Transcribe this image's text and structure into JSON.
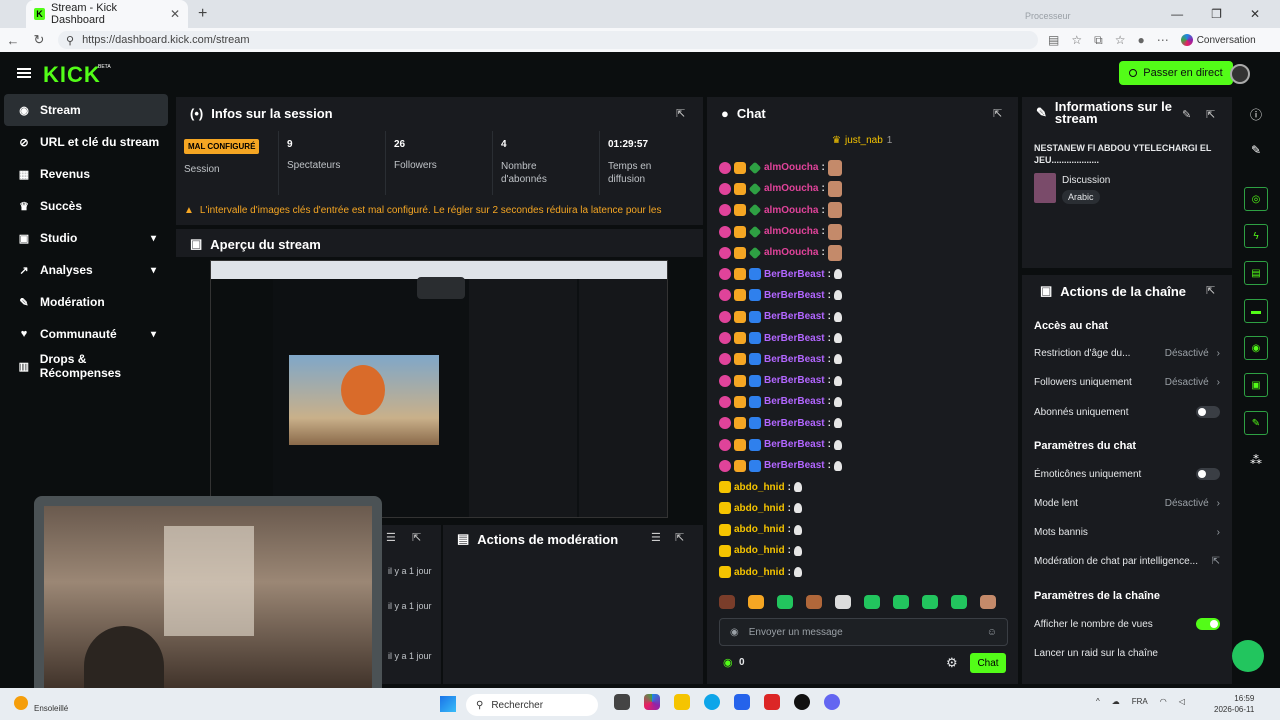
{
  "browser": {
    "tab_title": "Stream - Kick Dashboard",
    "url": "https://dashboard.kick.com/stream",
    "conversation_label": "Conversation",
    "processor_label": "Processeur"
  },
  "header": {
    "logo": "KICK",
    "beta": "BETA",
    "go_live_label": "Passer en direct"
  },
  "sidebar": {
    "items": [
      {
        "label": "Stream",
        "icon": "broadcast-icon"
      },
      {
        "label": "URL et clé du stream",
        "icon": "link-icon"
      },
      {
        "label": "Revenus",
        "icon": "money-icon"
      },
      {
        "label": "Succès",
        "icon": "trophy-icon"
      },
      {
        "label": "Studio",
        "icon": "studio-icon"
      },
      {
        "label": "Analyses",
        "icon": "chart-icon"
      },
      {
        "label": "Modération",
        "icon": "wrench-icon"
      },
      {
        "label": "Communauté",
        "icon": "community-icon"
      },
      {
        "label": "Drops & Récompenses",
        "icon": "gift-icon"
      }
    ]
  },
  "session": {
    "title": "Infos sur la session",
    "status_badge": "MAL CONFIGURÉ",
    "status_label": "Session",
    "stats": [
      {
        "value": "9",
        "label": "Spectateurs"
      },
      {
        "value": "26",
        "label": "Followers"
      },
      {
        "value": "4",
        "label": "Nombre d'abonnés"
      },
      {
        "value": "01:29:57",
        "label": "Temps en diffusion"
      }
    ],
    "warning": "L'intervalle d'images clés d'entrée est mal configuré. Le régler sur 2 secondes réduira la latence pour les spectateurs"
  },
  "preview": {
    "title": "Aperçu du stream"
  },
  "activity": {
    "times": [
      "il y a 1 jour",
      "il y a 1 jour",
      "il y a 1 jour"
    ]
  },
  "moderation": {
    "title": "Actions de modération"
  },
  "chat": {
    "title": "Chat",
    "pinned_user": "just_nab",
    "pinned_count": "1",
    "messages": [
      {
        "user": "almOoucha",
        "color": "#e0439a",
        "badges": [
          "pink",
          "gold",
          "green"
        ],
        "emote": "face"
      },
      {
        "user": "almOoucha",
        "color": "#e0439a",
        "badges": [
          "pink",
          "gold",
          "green"
        ],
        "emote": "face"
      },
      {
        "user": "almOoucha",
        "color": "#e0439a",
        "badges": [
          "pink",
          "gold",
          "green"
        ],
        "emote": "face"
      },
      {
        "user": "almOoucha",
        "color": "#e0439a",
        "badges": [
          "pink",
          "gold",
          "green"
        ],
        "emote": "face"
      },
      {
        "user": "almOoucha",
        "color": "#e0439a",
        "badges": [
          "pink",
          "gold",
          "green"
        ],
        "emote": "face"
      },
      {
        "user": "BerBerBeast",
        "color": "#b266ff",
        "badges": [
          "pink",
          "gold",
          "blue"
        ],
        "emote": "bird"
      },
      {
        "user": "BerBerBeast",
        "color": "#b266ff",
        "badges": [
          "pink",
          "gold",
          "blue"
        ],
        "emote": "bird"
      },
      {
        "user": "BerBerBeast",
        "color": "#b266ff",
        "badges": [
          "pink",
          "gold",
          "blue"
        ],
        "emote": "bird"
      },
      {
        "user": "BerBerBeast",
        "color": "#b266ff",
        "badges": [
          "pink",
          "gold",
          "blue"
        ],
        "emote": "bird"
      },
      {
        "user": "BerBerBeast",
        "color": "#b266ff",
        "badges": [
          "pink",
          "gold",
          "blue"
        ],
        "emote": "bird"
      },
      {
        "user": "BerBerBeast",
        "color": "#b266ff",
        "badges": [
          "pink",
          "gold",
          "blue"
        ],
        "emote": "bird"
      },
      {
        "user": "BerBerBeast",
        "color": "#b266ff",
        "badges": [
          "pink",
          "gold",
          "blue"
        ],
        "emote": "bird"
      },
      {
        "user": "BerBerBeast",
        "color": "#b266ff",
        "badges": [
          "pink",
          "gold",
          "blue"
        ],
        "emote": "bird"
      },
      {
        "user": "BerBerBeast",
        "color": "#b266ff",
        "badges": [
          "pink",
          "gold",
          "blue"
        ],
        "emote": "bird"
      },
      {
        "user": "BerBerBeast",
        "color": "#b266ff",
        "badges": [
          "pink",
          "gold",
          "blue"
        ],
        "emote": "bird"
      },
      {
        "user": "abdo_hnid",
        "color": "#f5c400",
        "badges": [
          "yel"
        ],
        "emote": "bird"
      },
      {
        "user": "abdo_hnid",
        "color": "#f5c400",
        "badges": [
          "yel"
        ],
        "emote": "bird"
      },
      {
        "user": "abdo_hnid",
        "color": "#f5c400",
        "badges": [
          "yel"
        ],
        "emote": "bird"
      },
      {
        "user": "abdo_hnid",
        "color": "#f5c400",
        "badges": [
          "yel"
        ],
        "emote": "bird"
      },
      {
        "user": "abdo_hnid",
        "color": "#f5c400",
        "badges": [
          "yel"
        ],
        "emote": "bird"
      }
    ],
    "input_placeholder": "Envoyer un message",
    "viewer_count": "0",
    "send_label": "Chat"
  },
  "stream_info": {
    "title": "Informations sur le stream",
    "stream_title": "NESTANEW FI ABDOU YTELECHARGI EL JEU...................",
    "category": "Discussion",
    "tag": "Arabic"
  },
  "channel_actions": {
    "title": "Actions de la chaîne",
    "sections": {
      "chat_access": "Accès au chat",
      "chat_settings": "Paramètres du chat",
      "channel_settings": "Paramètres de la chaîne"
    },
    "rows": {
      "age_restriction": "Restriction d'âge du...",
      "age_restriction_value": "Désactivé",
      "followers_only": "Followers uniquement",
      "followers_only_value": "Désactivé",
      "subs_only": "Abonnés uniquement",
      "emotes_only": "Émoticônes uniquement",
      "slow_mode": "Mode lent",
      "slow_mode_value": "Désactivé",
      "banned_words": "Mots bannis",
      "ai_moderation": "Modération de chat par intelligence...",
      "show_views": "Afficher le nombre de vues",
      "raid": "Lancer un raid sur la chaîne"
    },
    "toggles": {
      "subs_only": false,
      "emotes_only": false,
      "show_views": true
    }
  },
  "taskbar": {
    "search_label": "Rechercher",
    "weather": "Ensoleillé",
    "lang": "FRA",
    "time": "16:59",
    "date": "2026-06-11"
  },
  "colors": {
    "accent": "#53fc18",
    "panel": "#191b1f",
    "warning": "#f5a623"
  }
}
